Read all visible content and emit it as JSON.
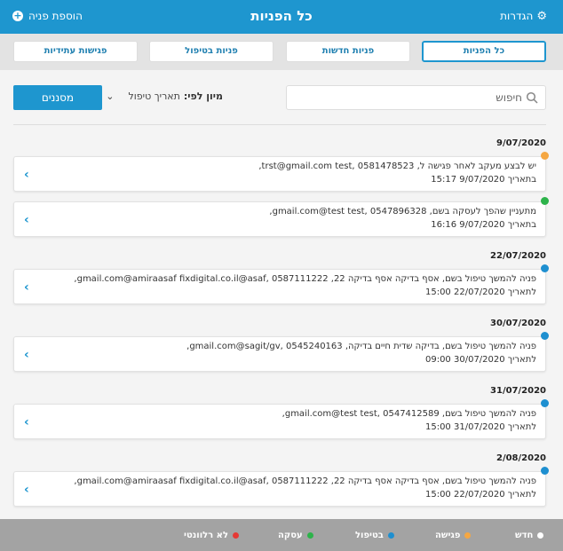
{
  "header": {
    "title": "כל הפניות",
    "settings_label": "הגדרות",
    "add_label": "הוספת פניה"
  },
  "tabs": [
    {
      "label": "כל הפניות",
      "active": true
    },
    {
      "label": "פניות חדשות",
      "active": false
    },
    {
      "label": "פניות בטיפול",
      "active": false
    },
    {
      "label": "פגישות עתידיות",
      "active": false
    }
  ],
  "search": {
    "placeholder": "חיפוש"
  },
  "sort": {
    "label": "מיון לפי:",
    "value": "תאריך טיפול"
  },
  "filter_label": "מסננים",
  "groups": [
    {
      "date": "9/07/2020",
      "item": {
        "line1": "יש לבצע מעקב לאחר פגישה ל, 0581478523 ,trst@gmail.com test,",
        "line2": "בתאריך 9/07/2020 15:17",
        "status_color": "#f5a742"
      }
    },
    {
      "date": "",
      "item": {
        "line1": "מתעניין שהפך לעסקה בשם, 0547896328 ,gmail.com@test test,",
        "line2": "בתאריך 9/07/2020 16:16",
        "status_color": "#2db34a"
      }
    },
    {
      "date": "22/07/2020",
      "item": {
        "line1": "פניה להמשך טיפול בשם, אסף בדיקה אסף בדיקה 22, 0587111222 ,gmail.com@amiraasaf fixdigital.co.il@asaf,",
        "line2": "לתאריך 22/07/2020 15:00",
        "status_color": "#1e8fd0"
      }
    },
    {
      "date": "30/07/2020",
      "item": {
        "line1": "פניה להמשך טיפול בשם, בדיקה שדית חיים בדיקה, 0545240163 ,gmail.com@sagit/gv,",
        "line2": "לתאריך 30/07/2020 09:00",
        "status_color": "#1e8fd0"
      }
    },
    {
      "date": "31/07/2020",
      "item": {
        "line1": "פניה להמשך טיפול בשם, 0547412589 ,gmail.com@test test,",
        "line2": "לתאריך 31/07/2020 15:00",
        "status_color": "#1e8fd0"
      }
    },
    {
      "date": "2/08/2020",
      "item": {
        "line1": "פניה להמשך טיפול בשם, אסף בדיקה אסף בדיקה 22, 0587111222 ,gmail.com@amiraasaf fixdigital.co.il@asaf,",
        "line2": "לתאריך 22/07/2020 15:00",
        "status_color": "#1e8fd0"
      }
    }
  ],
  "legend": [
    {
      "label": "חדש",
      "color": "#ffffff"
    },
    {
      "label": "פגישה",
      "color": "#f5a742"
    },
    {
      "label": "בטיפול",
      "color": "#1e8fd0"
    },
    {
      "label": "עסקה",
      "color": "#2db34a"
    },
    {
      "label": "לא רלוונטי",
      "color": "#e53935"
    }
  ]
}
